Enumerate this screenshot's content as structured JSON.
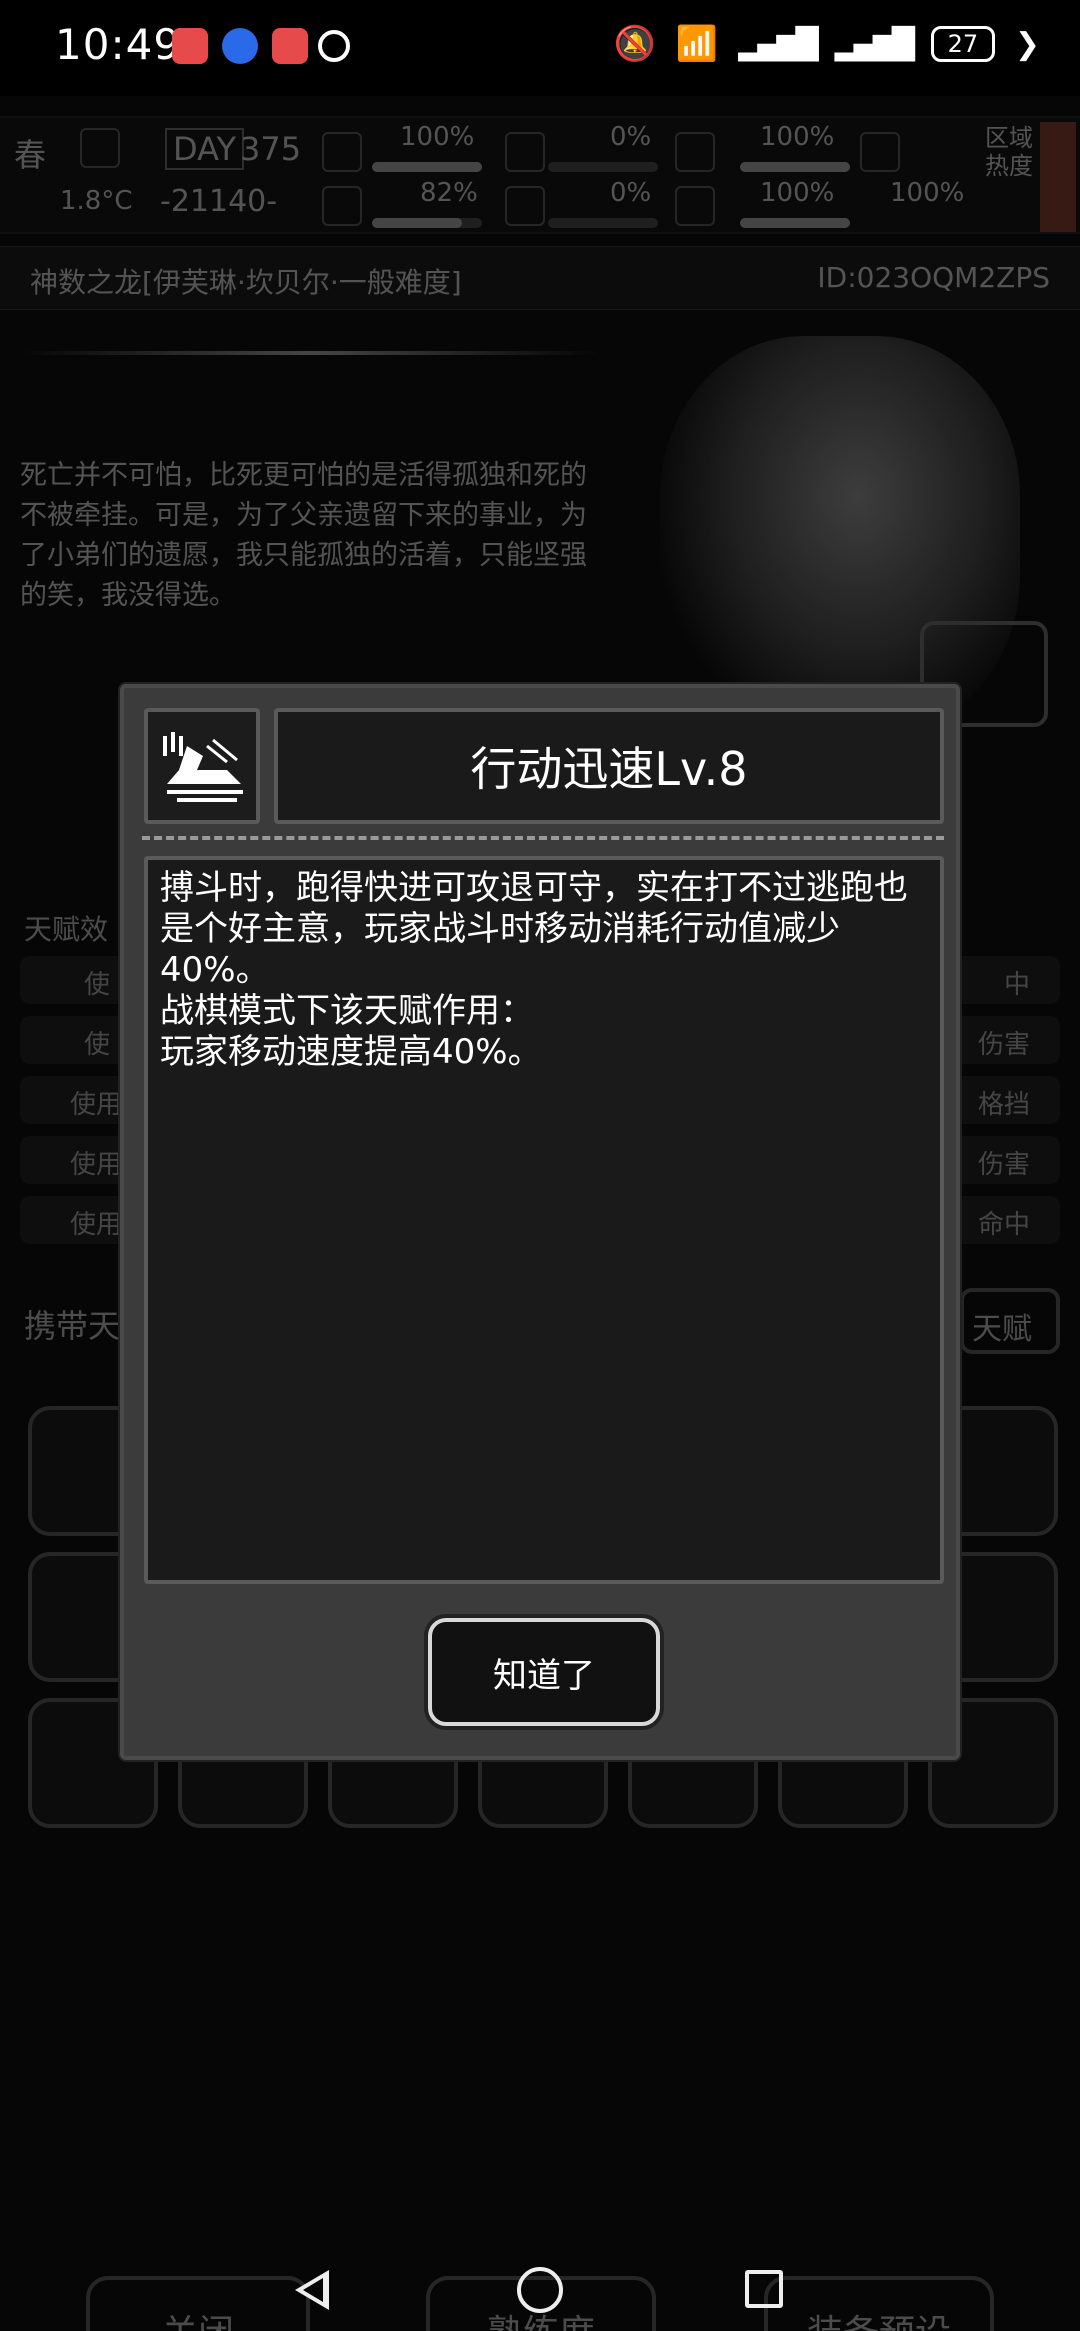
{
  "status_bar": {
    "time": "10:49",
    "battery": "27"
  },
  "hud": {
    "season": "春",
    "day_label": "DAY",
    "day_value": "375",
    "temperature": "1.8°C",
    "coordinate": "-21140-",
    "stat1": "100%",
    "stat2": "0%",
    "stat3": "100%",
    "stat4": "82%",
    "stat5": "0%",
    "stat6": "100%",
    "stat7": "100%",
    "region_heat": "区域热度"
  },
  "background": {
    "character_title": "神数之龙[伊芙琳·坎贝尔·一般难度]",
    "character_id": "ID:023OQM2ZPS",
    "bio": "死亡并不可怕，比死更可怕的是活得孤独和死的不被牵挂。可是，为了父亲遗留下来的事业，为了小弟们的遗愿，我只能孤独的活着，只能坚强的笑，我没得选。",
    "effects_label": "天赋效",
    "carry_label": "携带天",
    "carry_right": "天赋",
    "effect_rows": [
      {
        "left": "使",
        "right": "中"
      },
      {
        "left": "使",
        "right": "伤害"
      },
      {
        "left": "使用",
        "right": "格挡"
      },
      {
        "left": "使用",
        "right": "伤害"
      },
      {
        "left": "使用",
        "right": "命中"
      }
    ],
    "buttons": {
      "close": "关闭",
      "proficiency": "熟练度",
      "equip_preset": "装备预设"
    }
  },
  "modal": {
    "title": "行动迅速Lv.8",
    "icon": "sprint-icon",
    "description_lines": [
      "搏斗时，跑得快进可攻退可守，实在打不过逃跑也是个好主意，玩家战斗时移动消耗行动值减少40%。",
      "战棋模式下该天赋作用：",
      "玩家移动速度提高40%。"
    ],
    "ok_button": "知道了"
  }
}
